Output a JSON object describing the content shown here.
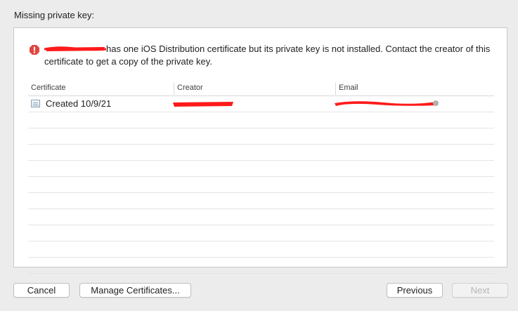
{
  "header": {
    "title": "Missing private key:"
  },
  "message": {
    "text": "has one iOS Distribution certificate but its private key is not installed. Contact the creator of this certificate to get a copy of the private key."
  },
  "table": {
    "columns": [
      "Certificate",
      "Creator",
      "Email"
    ],
    "rows": [
      {
        "certificate": "Created 10/9/21"
      }
    ]
  },
  "buttons": {
    "cancel": "Cancel",
    "manage": "Manage Certificates...",
    "previous": "Previous",
    "next": "Next"
  },
  "colors": {
    "warning": "#e0473e",
    "redaction": "#ff1a1a"
  }
}
